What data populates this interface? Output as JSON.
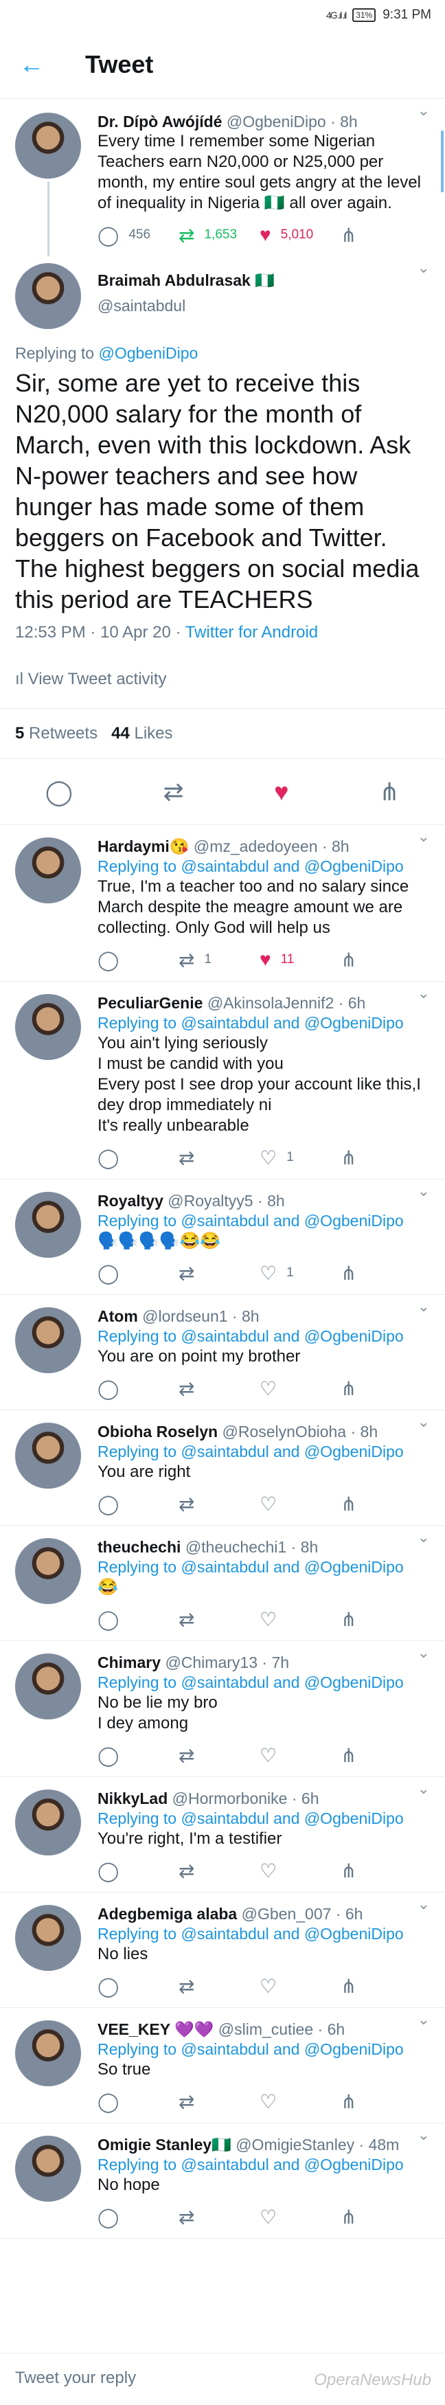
{
  "status": {
    "signal": "4G .ıl .ıl",
    "battery": "31%",
    "time": "9:31 PM"
  },
  "header": {
    "title": "Tweet"
  },
  "parent": {
    "name": "Dr. Dípò Awójídé",
    "handle": "@OgbeniDipo",
    "age": "8h",
    "text": "Every time I remember some Nigerian Teachers earn N20,000 or N25,000 per month, my entire soul gets angry at the level of inequality in Nigeria 🇳🇬 all over again.",
    "replies": "456",
    "retweets": "1,653",
    "likes": "5,010"
  },
  "focus": {
    "name": "Braimah Abdulrasak 🇳🇬",
    "handle": "@saintabdul",
    "replying": "Replying to ",
    "replying_to": "@OgbeniDipo",
    "text": "Sir, some are yet to receive this N20,000 salary for the month of March, even with this lockdown. Ask N-power teachers and see how hunger has made some of them beggers on Facebook and Twitter. The highest beggers on social media this period are TEACHERS",
    "time": "12:53 PM · 10 Apr 20 · ",
    "client": "Twitter for Android",
    "activity": "View Tweet activity",
    "retweets": "5",
    "retweets_label": " Retweets",
    "likes": "44",
    "likes_label": " Likes"
  },
  "replies": [
    {
      "name": "Hardaymi😘",
      "handle": "@mz_adedoyeen",
      "age": "8h",
      "to": "@saintabdul and @OgbeniDipo",
      "text": "True, I'm a teacher too and no salary since March despite the meagre amount we are collecting. Only God will help us",
      "retweets": "1",
      "likes": "11",
      "liked": true
    },
    {
      "name": "PeculiarGenie",
      "handle": "@AkinsolaJennif2",
      "age": "6h",
      "to": "@saintabdul and @OgbeniDipo",
      "text": "You ain't lying seriously\nI must be candid with you\nEvery post I see drop your account like this,I dey drop immediately ni\nIt's really unbearable",
      "retweets": "",
      "likes": "1",
      "liked": false
    },
    {
      "name": "Royaltyy",
      "handle": "@Royaltyy5",
      "age": "8h",
      "to": "@saintabdul and @OgbeniDipo",
      "text": "🗣️🗣️🗣️🗣️😂😂",
      "retweets": "",
      "likes": "1",
      "liked": false
    },
    {
      "name": "Atom",
      "handle": "@lordseun1",
      "age": "8h",
      "to": "@saintabdul and @OgbeniDipo",
      "text": "You are on point my brother",
      "retweets": "",
      "likes": "",
      "liked": false
    },
    {
      "name": "Obioha Roselyn",
      "handle": "@RoselynObioha",
      "age": "8h",
      "to": "@saintabdul and @OgbeniDipo",
      "text": "You are right",
      "retweets": "",
      "likes": "",
      "liked": false
    },
    {
      "name": "theuchechi",
      "handle": "@theuchechi1",
      "age": "8h",
      "to": "@saintabdul and @OgbeniDipo",
      "text": "😂",
      "retweets": "",
      "likes": "",
      "liked": false
    },
    {
      "name": "Chimary",
      "handle": "@Chimary13",
      "age": "7h",
      "to": "@saintabdul and @OgbeniDipo",
      "text": "No be lie my bro\nI dey among",
      "retweets": "",
      "likes": "",
      "liked": false
    },
    {
      "name": "NikkyLad",
      "handle": "@Hormorbonike",
      "age": "6h",
      "to": "@saintabdul and @OgbeniDipo",
      "text": "You're right, I'm a testifier",
      "retweets": "",
      "likes": "",
      "liked": false
    },
    {
      "name": "Adegbemiga alaba",
      "handle": "@Gben_007",
      "age": "6h",
      "to": "@saintabdul and @OgbeniDipo",
      "text": "No lies",
      "retweets": "",
      "likes": "",
      "liked": false
    },
    {
      "name": "VEE_KEY 💜💜",
      "handle": "@slim_cutiee",
      "age": "6h",
      "to": "@saintabdul and @OgbeniDipo",
      "text": "So true",
      "retweets": "",
      "likes": "",
      "liked": false
    },
    {
      "name": "Omigie Stanley🇳🇬",
      "handle": "@OmigieStanley",
      "age": "48m",
      "to": "@saintabdul and @OgbeniDipo",
      "text": "No hope",
      "retweets": "",
      "likes": "",
      "liked": false
    }
  ],
  "labels": {
    "replying": "Replying to "
  },
  "compose": {
    "placeholder": "Tweet your reply"
  },
  "watermark": "OperaNewsHub",
  "colors": {
    "accent": "#1da1f2",
    "like": "#e0245e",
    "retweet": "#17bf63"
  }
}
